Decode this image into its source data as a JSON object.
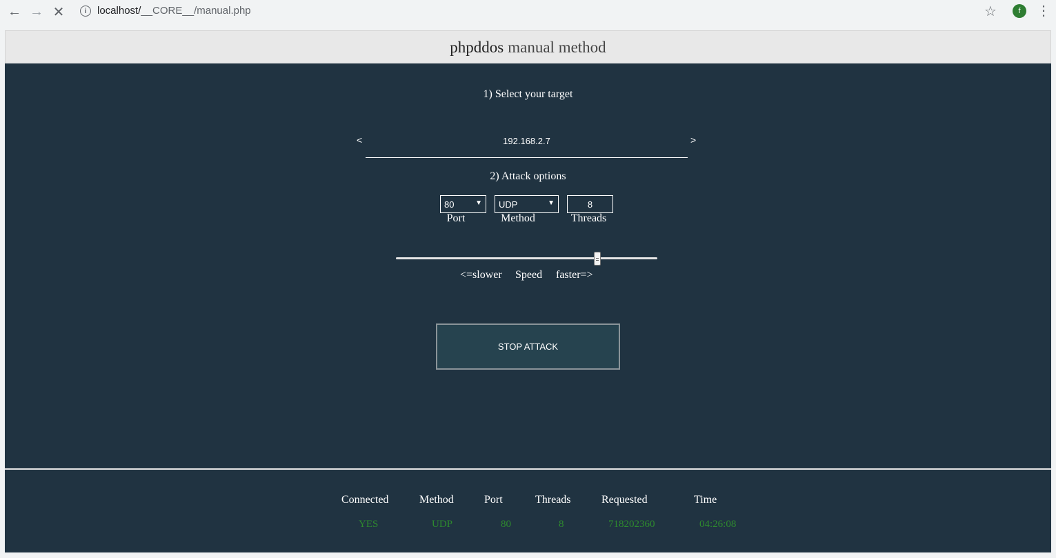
{
  "browser": {
    "url_host": "localhost/",
    "url_path": "__CORE__/manual.php",
    "avatar_letter": "f"
  },
  "header": {
    "title_main": "phpddos",
    "title_rest": "manual method"
  },
  "target": {
    "step_label": "1) Select your target",
    "prev": "<",
    "next": ">",
    "ip": "192.168.2.7"
  },
  "options": {
    "step_label": "2) Attack options",
    "port_value": "80",
    "port_label": "Port",
    "method_value": "UDP",
    "method_label": "Method",
    "threads_value": "8",
    "threads_label": "Threads"
  },
  "speed": {
    "level": 0.77,
    "slower_label": "<=slower",
    "label": "Speed",
    "faster_label": "faster=>"
  },
  "action": {
    "stop_label": "STOP ATTACK"
  },
  "status": {
    "headers": [
      "Connected",
      "Method",
      "Port",
      "Threads",
      "Requested",
      "Time"
    ],
    "values": [
      "YES",
      "UDP",
      "80",
      "8",
      "718202360",
      "04:26:08"
    ],
    "value_color": "#2e8b2e"
  },
  "colors": {
    "background": "#203341",
    "header_bg": "#e8e8e8",
    "button_bg": "#26434f"
  }
}
